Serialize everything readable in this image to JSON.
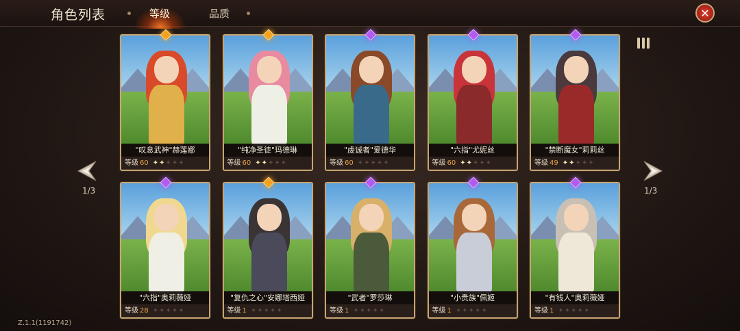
{
  "header": {
    "title": "角色列表",
    "tabs": [
      {
        "label": "等级",
        "active": true
      },
      {
        "label": "品质",
        "active": false
      }
    ]
  },
  "pager": {
    "left": "1/3",
    "right": "1/3"
  },
  "version": "Z.1.1(1191742)",
  "level_label": "等级",
  "colors": {
    "accent": "#e7a04b",
    "gold_gem": "#f2a21c",
    "purple_gem": "#b25bf0"
  },
  "cards": [
    {
      "name": "\"叹息武神\"赫莲娜",
      "level": "60",
      "stars": 2,
      "gem": "gold",
      "hair": "#d84a2a",
      "outfit": "#e0b04a"
    },
    {
      "name": "\"纯净圣徒\"玛德琳",
      "level": "60",
      "stars": 2,
      "gem": "gold",
      "hair": "#e88aa0",
      "outfit": "#eef0e6"
    },
    {
      "name": "\"虔诚者\"爱德华",
      "level": "60",
      "stars": 0,
      "gem": "purple",
      "hair": "#8a4a2a",
      "outfit": "#3a6a8a"
    },
    {
      "name": "\"六指\"尤妮丝",
      "level": "60",
      "stars": 2,
      "gem": "purple",
      "hair": "#c8343a",
      "outfit": "#8a2a2a"
    },
    {
      "name": "\"禁断魔女\"莉莉丝",
      "level": "49",
      "stars": 2,
      "gem": "purple",
      "hair": "#4a3a3e",
      "outfit": "#9a2a2a"
    },
    {
      "name": "\"六指\"奥莉薇娅",
      "level": "28",
      "stars": 0,
      "gem": "purple",
      "hair": "#f0d890",
      "outfit": "#f0efe6"
    },
    {
      "name": "\"复仇之心\"安娜塔西娅",
      "level": "1",
      "stars": 0,
      "gem": "gold",
      "hair": "#3a3434",
      "outfit": "#4a4a5a"
    },
    {
      "name": "\"武者\"罗莎琳",
      "level": "1",
      "stars": 0,
      "gem": "purple",
      "hair": "#d8b06a",
      "outfit": "#4a5a3a"
    },
    {
      "name": "\"小贵族\"佩姬",
      "level": "1",
      "stars": 0,
      "gem": "purple",
      "hair": "#a8683a",
      "outfit": "#c8cdd8"
    },
    {
      "name": "\"有钱人\"奥莉薇娅",
      "level": "1",
      "stars": 0,
      "gem": "purple",
      "hair": "#c8c0b4",
      "outfit": "#efe8d8"
    }
  ]
}
